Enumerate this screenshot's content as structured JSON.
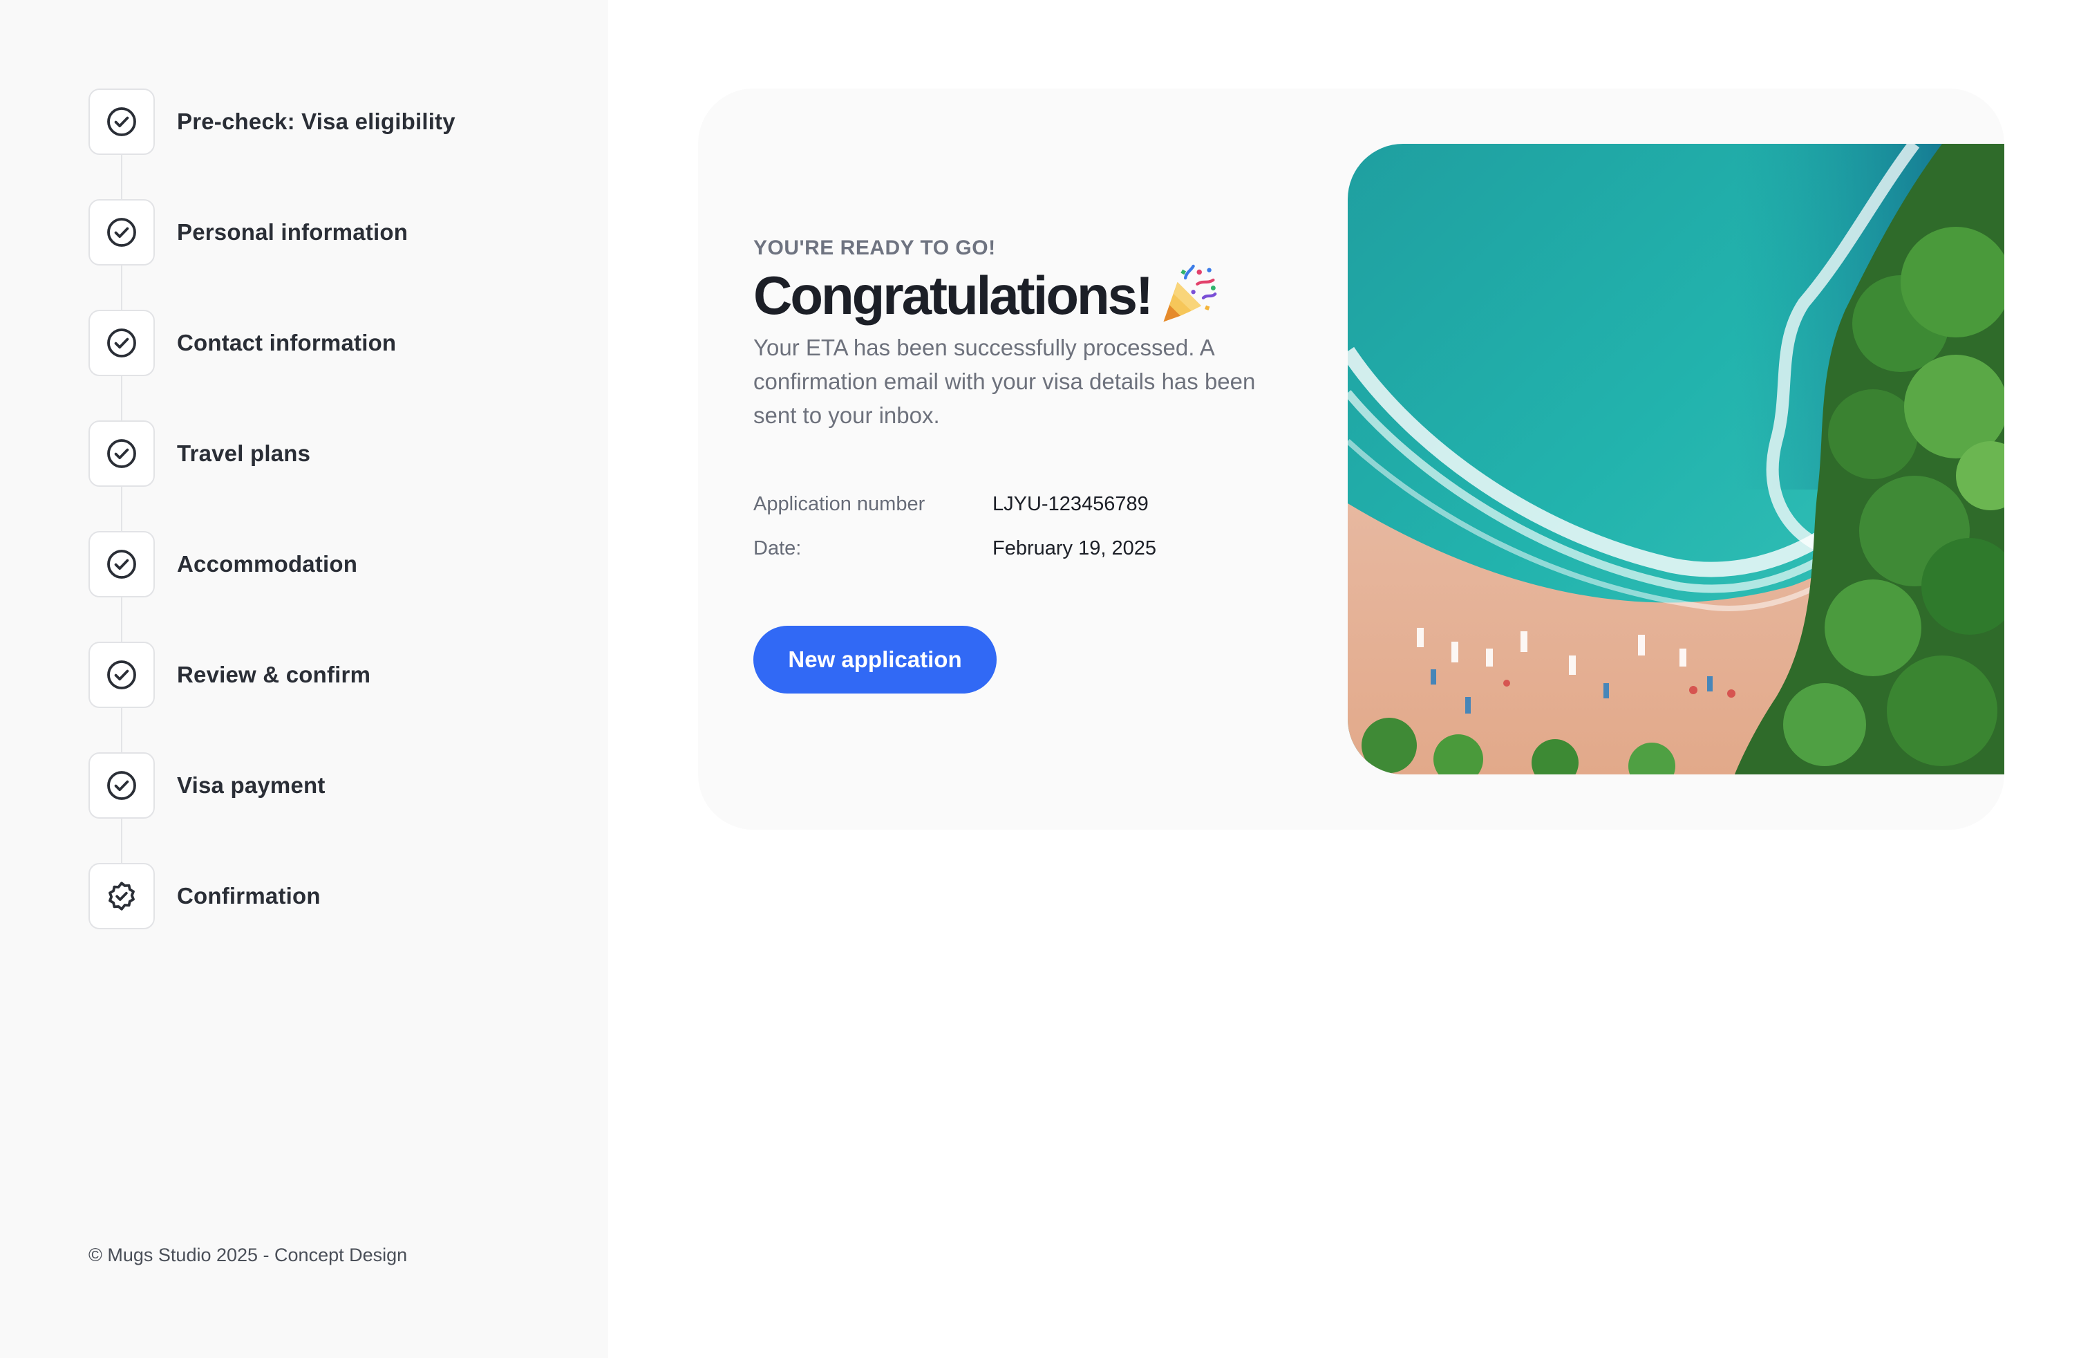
{
  "sidebar": {
    "steps": [
      {
        "label": "Pre-check: Visa eligibility",
        "icon": "check-circle-icon",
        "status": "completed"
      },
      {
        "label": "Personal information",
        "icon": "check-circle-icon",
        "status": "completed"
      },
      {
        "label": "Contact information",
        "icon": "check-circle-icon",
        "status": "completed"
      },
      {
        "label": "Travel plans",
        "icon": "check-circle-icon",
        "status": "completed"
      },
      {
        "label": "Accommodation",
        "icon": "check-circle-icon",
        "status": "completed"
      },
      {
        "label": "Review & confirm",
        "icon": "check-circle-icon",
        "status": "completed"
      },
      {
        "label": "Visa payment",
        "icon": "check-circle-icon",
        "status": "completed"
      },
      {
        "label": "Confirmation",
        "icon": "verified-badge-icon",
        "status": "current"
      }
    ],
    "footer": "© Mugs Studio 2025 - Concept Design"
  },
  "main": {
    "eyebrow": "YOU'RE READY TO GO!",
    "title": "Congratulations!",
    "title_icon": "party-popper-icon",
    "description": "Your ETA has been successfully processed. A confirmation email with your visa details has been sent to your inbox.",
    "details": {
      "application_number_label": "Application number",
      "application_number": "LJYU-123456789",
      "date_label": "Date:",
      "date": "February 19, 2025"
    },
    "new_application_button": "New application",
    "image": "aerial-beach-image"
  },
  "colors": {
    "accent": "#3169f5",
    "sidebar_bg": "#f9f9f9",
    "card_bg": "#fafafa",
    "text_dark": "#1c1f27",
    "text_muted": "#6d717c"
  }
}
